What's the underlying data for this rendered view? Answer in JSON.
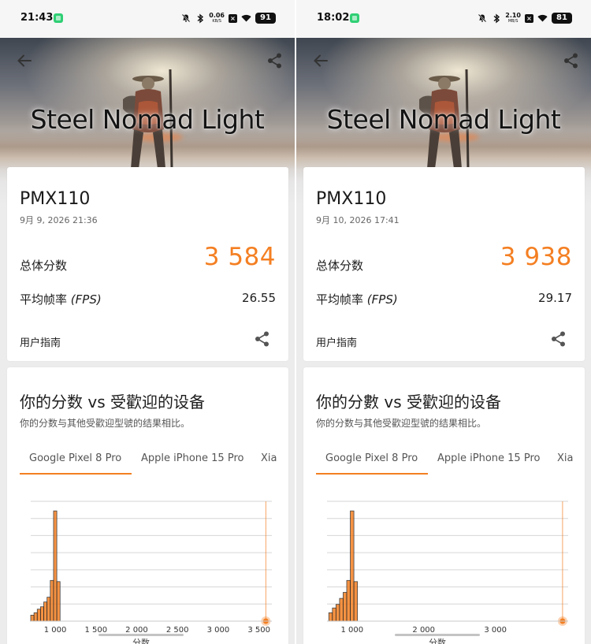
{
  "screens": [
    {
      "status": {
        "time": "21:43",
        "net_speed": "0.06",
        "net_unit": "KB/S",
        "battery": "91"
      },
      "hero_title": "Steel Nomad Light",
      "device": "PMX110",
      "datetime": "9月 9, 2026 21:36",
      "score_label": "总体分数",
      "score": "3 584",
      "fps_label": "平均帧率",
      "fps_unit": "(FPS)",
      "fps": "26.55",
      "guide": "用户指南",
      "compare_title": "你的分数 vs 受歡迎的设备",
      "compare_subtitle": "你的分数与其他受歡迎型號的结果相比。",
      "tabs": [
        "Google Pixel 8 Pro",
        "Apple iPhone 15 Pro",
        "Xia"
      ],
      "chart_data": {
        "type": "bar",
        "xlabel": "分数",
        "tick_labels": [
          "1 000",
          "1 500",
          "2 000",
          "2 500",
          "3 000",
          "3 500"
        ],
        "ticks": [
          1000,
          1500,
          2000,
          2500,
          3000,
          3500
        ],
        "xlim": [
          700,
          3600
        ],
        "distribution": {
          "bins": [
            720,
            760,
            800,
            840,
            880,
            920,
            960,
            1000,
            1040
          ],
          "values": [
            5,
            7,
            10,
            12,
            16,
            20,
            34,
            92,
            33
          ]
        },
        "your_score": 3584,
        "ylim": [
          0,
          100
        ],
        "accent": "#f47f22"
      }
    },
    {
      "status": {
        "time": "18:02",
        "net_speed": "2.10",
        "net_unit": "MB/S",
        "battery": "81"
      },
      "hero_title": "Steel Nomad Light",
      "device": "PMX110",
      "datetime": "9月 10, 2026 17:41",
      "score_label": "总体分数",
      "score": "3 938",
      "fps_label": "平均帧率",
      "fps_unit": "(FPS)",
      "fps": "29.17",
      "guide": "用户指南",
      "compare_title": "你的分數 vs 受歡迎的设备",
      "compare_subtitle": "你的分数与其他受歡迎型號的结果相比。",
      "tabs": [
        "Google Pixel 8 Pro",
        "Apple iPhone 15 Pro",
        "Xia"
      ],
      "chart_data": {
        "type": "bar",
        "xlabel": "分数",
        "tick_labels": [
          "1 000",
          "2 000",
          "3 000"
        ],
        "ticks": [
          1000,
          2000,
          3000
        ],
        "xlim": [
          650,
          3950
        ],
        "distribution": {
          "bins": [
            700,
            750,
            800,
            850,
            900,
            950,
            1000,
            1050
          ],
          "values": [
            7,
            11,
            14,
            19,
            24,
            34,
            92,
            33
          ]
        },
        "your_score": 3938,
        "ylim": [
          0,
          100
        ],
        "accent": "#f47f22"
      }
    }
  ]
}
